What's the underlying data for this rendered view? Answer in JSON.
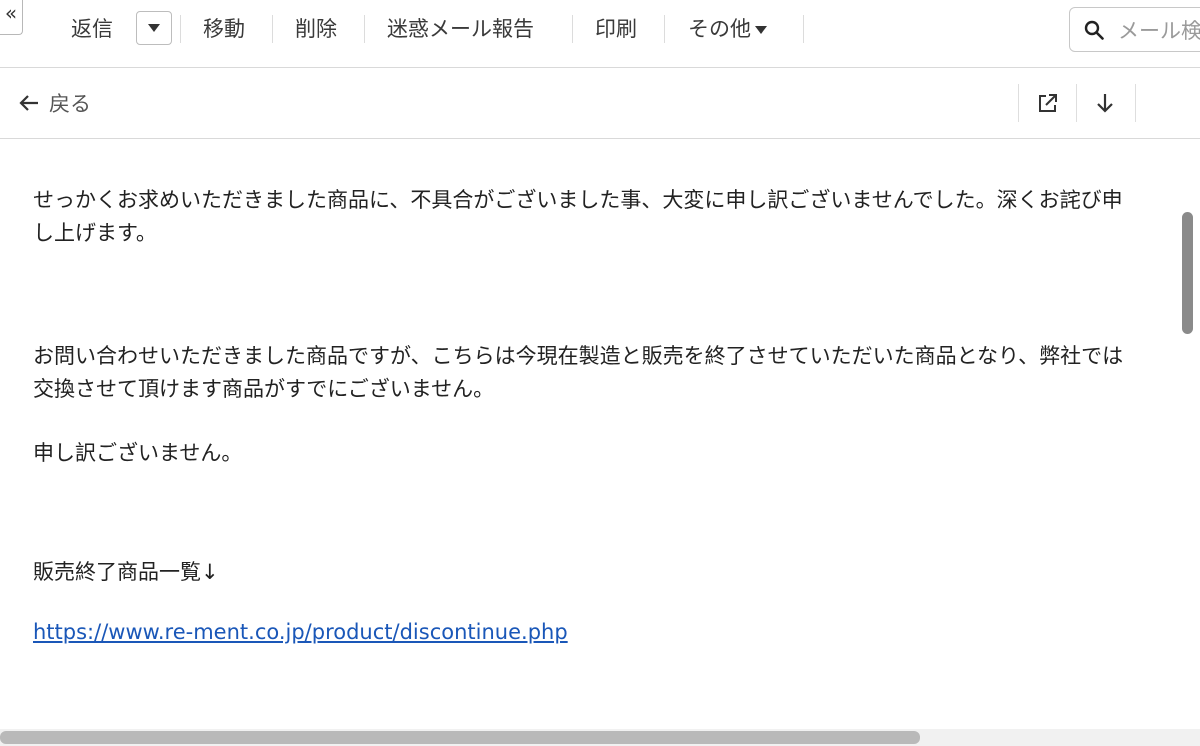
{
  "toolbar": {
    "collapse_glyph": "«",
    "reply_label": "返信",
    "move_label": "移動",
    "delete_label": "削除",
    "spam_label": "迷惑メール報告",
    "print_label": "印刷",
    "more_label": "その他",
    "search_placeholder": "メール検索"
  },
  "subbar": {
    "back_label": "戻る"
  },
  "message": {
    "paragraph1": "せっかくお求めいただきました商品に、不具合がございました事、大変に申し訳ございませんでした。深くお詫び申し上げます。",
    "paragraph2": "お問い合わせいただきました商品ですが、こちらは今現在製造と販売を終了させていただいた商品となり、弊社では交換させて頂けます商品がすでにございません。",
    "paragraph3": "申し訳ございません。",
    "list_heading": "販売終了商品一覧↓",
    "link_text": "https://www.re-ment.co.jp/product/discontinue.php"
  },
  "colors": {
    "link": "#1a57b8",
    "border": "#d9d9d9"
  }
}
